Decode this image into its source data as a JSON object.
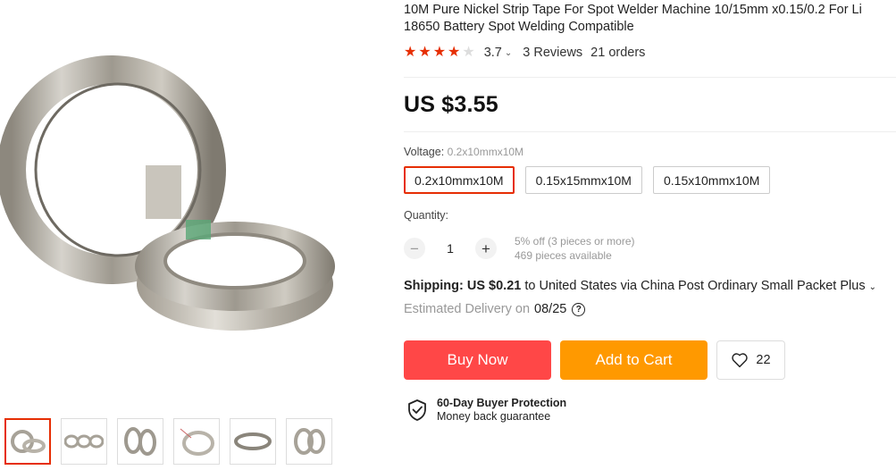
{
  "product": {
    "title": "10M Pure Nickel Strip Tape For Spot Welder Machine 10/15mm x0.15/0.2 For Li 18650 Battery Spot Welding Compatible",
    "rating_value": "3.7",
    "rating_stars": 3.7,
    "reviews": "3 Reviews",
    "orders": "21 orders",
    "price": "US $3.55"
  },
  "options": {
    "voltage_label": "Voltage:",
    "voltage_selected": "0.2x10mmx10M",
    "variants": [
      "0.2x10mmx10M",
      "0.15x15mmx10M",
      "0.15x10mmx10M"
    ]
  },
  "quantity": {
    "label": "Quantity:",
    "minus": "−",
    "value": "1",
    "plus": "+",
    "discount_note": "5% off (3 pieces or more)",
    "available": "469 pieces available"
  },
  "shipping": {
    "label": "Shipping:",
    "cost": "US $0.21",
    "rest": "to United States via China Post Ordinary Small Packet Plus",
    "estimated_label": "Estimated Delivery on",
    "date": "08/25",
    "help": "?"
  },
  "actions": {
    "buy_now": "Buy Now",
    "add_to_cart": "Add to Cart",
    "wish_count": "22"
  },
  "protection": {
    "title": "60-Day Buyer Protection",
    "subtitle": "Money back guarantee"
  },
  "colors": {
    "accent_red": "#e62e04",
    "buy_button": "#ff4747",
    "cart_button": "#ff9900"
  }
}
